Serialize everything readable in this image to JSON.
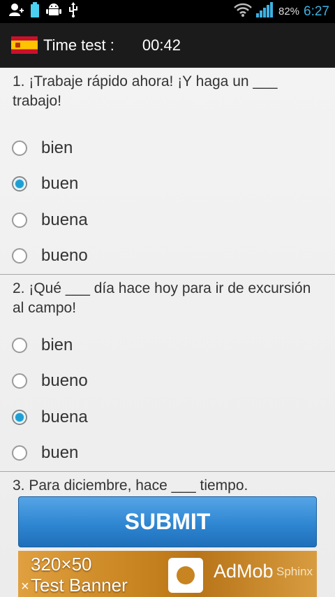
{
  "status_bar": {
    "battery_percent": "82%",
    "time": "6:27",
    "left_icons": [
      "add-contact-icon",
      "battery-full-icon",
      "android-icon",
      "usb-icon"
    ],
    "right_icons": [
      "wifi-icon",
      "signal-icon"
    ],
    "clock_color": "#3fb1e2"
  },
  "action_bar": {
    "flag_icon": "spain-flag-icon",
    "title": "Time test :",
    "timer": "00:42"
  },
  "questions": [
    {
      "text": "1. ¡Trabaje rápido ahora! ¡Y haga un ___ trabajo!",
      "options": [
        {
          "label": "bien",
          "checked": false
        },
        {
          "label": "buen",
          "checked": true
        },
        {
          "label": "buena",
          "checked": false
        },
        {
          "label": "bueno",
          "checked": false
        }
      ]
    },
    {
      "text": "2. ¡Qué ___ día hace hoy para ir de excursión al campo!",
      "options": [
        {
          "label": "bien",
          "checked": false
        },
        {
          "label": "bueno",
          "checked": false
        },
        {
          "label": "buena",
          "checked": true
        },
        {
          "label": "buen",
          "checked": false
        }
      ]
    },
    {
      "text": "3. Para diciembre, hace ___ tiempo.",
      "options": []
    }
  ],
  "submit_label": "SUBMIT",
  "ad": {
    "line1": "320×50",
    "line2": "Test Banner",
    "close": "×",
    "brand": "AdMob",
    "brand2": "Sphinx"
  },
  "colors": {
    "accent": "#1e9fd4",
    "submit": "#2f86d1",
    "action_bar": "#1b1b1b"
  }
}
